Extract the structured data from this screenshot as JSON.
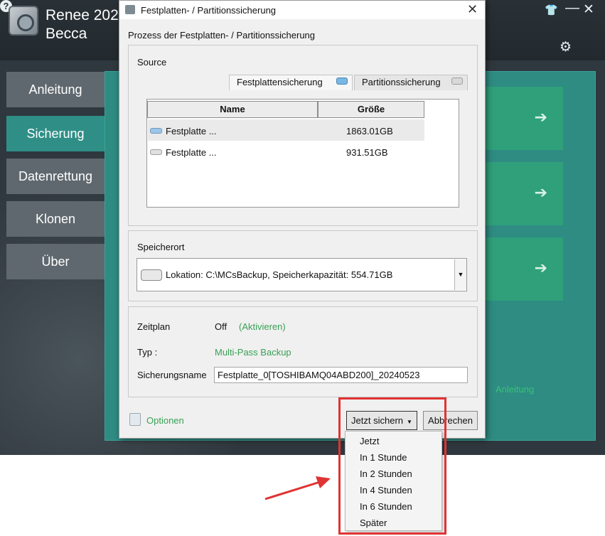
{
  "app": {
    "title_line1": "Renee 202",
    "title_line2": "Becca",
    "nav": [
      "Anleitung",
      "Sicherung",
      "Datenrettung",
      "Klonen",
      "Über"
    ],
    "active_nav": "Sicherung",
    "link": "Anleitung",
    "icons": [
      "shirt-icon",
      "minimize-icon",
      "close-icon",
      "gear-icon",
      "help-icon"
    ],
    "accent_color": "#2f8f87"
  },
  "dialog": {
    "title": "Festplatten- / Partitionssicherung",
    "heading": "Prozess der Festplatten- / Partitionssicherung",
    "source": {
      "label": "Source",
      "tabs": [
        "Festplattensicherung",
        "Partitionssicherung"
      ],
      "active_tab": "Festplattensicherung",
      "columns": [
        "Name",
        "Größe"
      ],
      "rows": [
        {
          "name": "Festplatte ...",
          "size": "1863.01GB"
        },
        {
          "name": "Festplatte ...",
          "size": "931.51GB"
        }
      ]
    },
    "storage": {
      "label": "Speicherort",
      "location": "Lokation: C:\\MCsBackup, Speicherkapazität: 554.71GB"
    },
    "schedule": {
      "zeitplan_label": "Zeitplan",
      "zeitplan_value": "Off",
      "activate_link": "(Aktivieren)",
      "typ_label": "Typ :",
      "typ_value": "Multi-Pass Backup",
      "name_label": "Sicherungsname",
      "name_value": "Festplatte_0[TOSHIBAMQ04ABD200]_20240523"
    },
    "options_label": "Optionen",
    "save_button": "Jetzt sichern",
    "cancel_button": "Abbrechen"
  },
  "dropdown_menu": [
    "Jetzt",
    "In 1 Stunde",
    "In 2 Stunden",
    "In 4 Stunden",
    "In 6 Stunden",
    "Später"
  ],
  "annotation_color": "#e03333"
}
